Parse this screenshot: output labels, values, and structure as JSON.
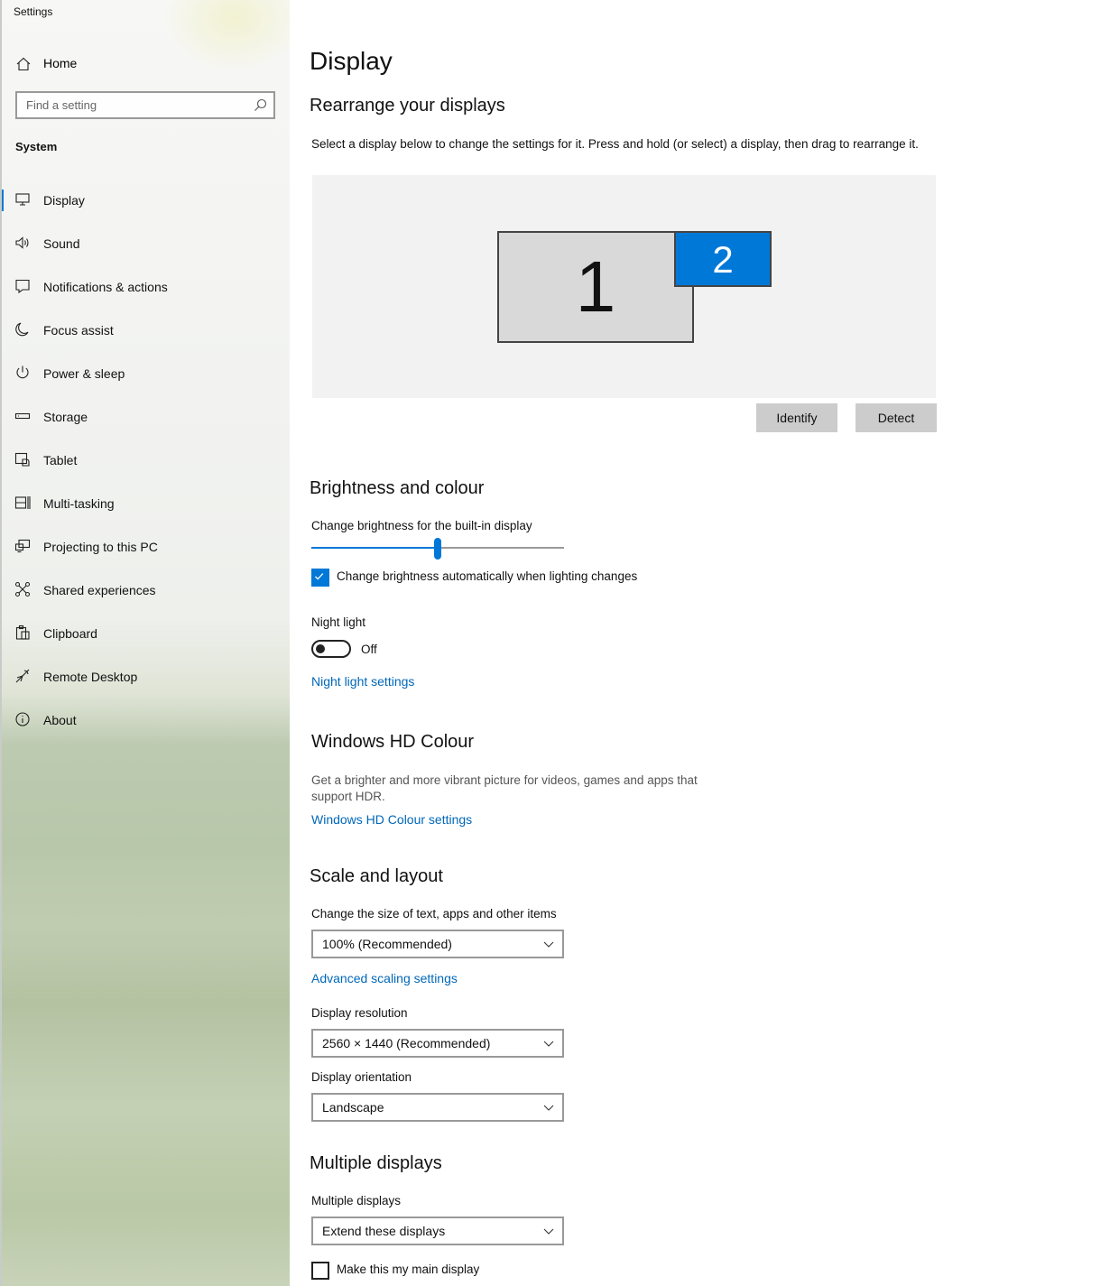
{
  "app": {
    "title": "Settings"
  },
  "sidebar": {
    "home_label": "Home",
    "search_placeholder": "Find a setting",
    "section_label": "System",
    "items": [
      {
        "label": "Display",
        "icon": "monitor-icon",
        "active": true
      },
      {
        "label": "Sound",
        "icon": "speaker-icon"
      },
      {
        "label": "Notifications & actions",
        "icon": "notification-icon"
      },
      {
        "label": "Focus assist",
        "icon": "moon-icon"
      },
      {
        "label": "Power & sleep",
        "icon": "power-icon"
      },
      {
        "label": "Storage",
        "icon": "storage-icon"
      },
      {
        "label": "Tablet",
        "icon": "tablet-icon"
      },
      {
        "label": "Multi-tasking",
        "icon": "multitasking-icon"
      },
      {
        "label": "Projecting to this PC",
        "icon": "projecting-icon"
      },
      {
        "label": "Shared experiences",
        "icon": "shared-experiences-icon"
      },
      {
        "label": "Clipboard",
        "icon": "clipboard-icon"
      },
      {
        "label": "Remote Desktop",
        "icon": "remote-desktop-icon"
      },
      {
        "label": "About",
        "icon": "info-icon"
      }
    ]
  },
  "main": {
    "page_title": "Display",
    "rearrange": {
      "heading": "Rearrange your displays",
      "description": "Select a display below to change the settings for it. Press and hold (or select) a display, then drag to rearrange it.",
      "display1_label": "1",
      "display2_label": "2",
      "identify_label": "Identify",
      "detect_label": "Detect"
    },
    "brightness": {
      "heading": "Brightness and colour",
      "slider_label": "Change brightness for the built-in display",
      "slider_value_percent": 50,
      "auto_checkbox_label": "Change brightness automatically when lighting changes",
      "auto_checked": true,
      "night_light_label": "Night light",
      "night_light_state": "Off",
      "night_light_link": "Night light settings"
    },
    "hd_colour": {
      "heading": "Windows HD Colour",
      "description_line1": "Get a brighter and more vibrant picture for videos, games and apps that",
      "description_line2": "support HDR.",
      "link": "Windows HD Colour settings"
    },
    "scale": {
      "heading": "Scale and layout",
      "size_label": "Change the size of text, apps and other items",
      "size_value": "100% (Recommended)",
      "advanced_link": "Advanced scaling settings",
      "resolution_label": "Display resolution",
      "resolution_value": "2560 × 1440 (Recommended)",
      "orientation_label": "Display orientation",
      "orientation_value": "Landscape"
    },
    "multiple": {
      "heading": "Multiple displays",
      "label": "Multiple displays",
      "value": "Extend these displays",
      "main_display_label": "Make this my main display",
      "main_display_checked": false
    }
  },
  "colors": {
    "accent": "#0078d7",
    "link": "#0067b8"
  }
}
